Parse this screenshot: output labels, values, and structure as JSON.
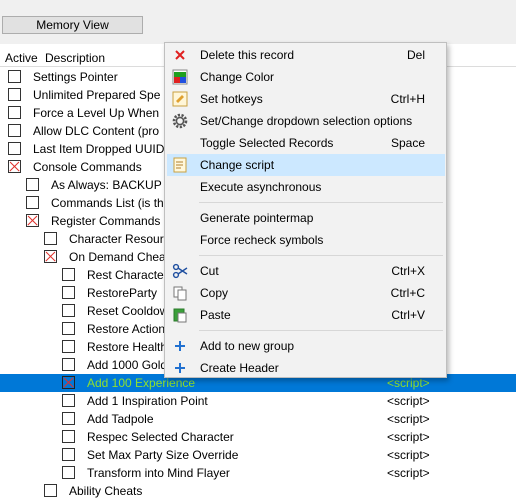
{
  "toolbar": {
    "memory_view_label": "Memory View"
  },
  "columns": {
    "active": "Active",
    "description": "Description"
  },
  "rows": [
    {
      "desc": "Settings Pointer",
      "value": "",
      "checked": false,
      "selected": false,
      "indent": 1
    },
    {
      "desc": "Unlimited Prepared Spe",
      "value": "",
      "checked": false,
      "selected": false,
      "indent": 1
    },
    {
      "desc": "Force a Level Up When",
      "value": "",
      "checked": false,
      "selected": false,
      "indent": 1
    },
    {
      "desc": "Allow DLC Content (pro",
      "value": "",
      "checked": false,
      "selected": false,
      "indent": 1
    },
    {
      "desc": "Last Item Dropped UUID",
      "value": "",
      "checked": false,
      "selected": false,
      "indent": 1
    },
    {
      "desc": "Console Commands",
      "value": "",
      "checked": true,
      "selected": false,
      "indent": 1
    },
    {
      "desc": "As Always: BACKUP Y",
      "value": "",
      "checked": false,
      "selected": false,
      "indent": 2
    },
    {
      "desc": "Commands List (is th",
      "value": "",
      "checked": false,
      "selected": false,
      "indent": 2
    },
    {
      "desc": "Register Commands",
      "value": "",
      "checked": true,
      "selected": false,
      "indent": 2
    },
    {
      "desc": "Character Resourc",
      "value": "",
      "checked": false,
      "selected": false,
      "indent": 3
    },
    {
      "desc": "On Demand Cheat",
      "value": "",
      "checked": true,
      "selected": false,
      "indent": 3
    },
    {
      "desc": "Rest Character",
      "value": "",
      "checked": false,
      "selected": false,
      "indent": 4
    },
    {
      "desc": "RestoreParty",
      "value": "",
      "checked": false,
      "selected": false,
      "indent": 4
    },
    {
      "desc": "Reset Cooldow",
      "value": "",
      "checked": false,
      "selected": false,
      "indent": 4
    },
    {
      "desc": "Restore Action",
      "value": "",
      "checked": false,
      "selected": false,
      "indent": 4
    },
    {
      "desc": "Restore Health",
      "value": "",
      "checked": false,
      "selected": false,
      "indent": 4
    },
    {
      "desc": "Add 1000 Gold",
      "value": "",
      "checked": false,
      "selected": false,
      "indent": 4
    },
    {
      "desc": "Add 100 Experience",
      "value": "<script>",
      "checked": true,
      "selected": true,
      "indent": 4
    },
    {
      "desc": "Add 1 Inspiration Point",
      "value": "<script>",
      "checked": false,
      "selected": false,
      "indent": 4
    },
    {
      "desc": "Add Tadpole",
      "value": "<script>",
      "checked": false,
      "selected": false,
      "indent": 4
    },
    {
      "desc": "Respec Selected Character",
      "value": "<script>",
      "checked": false,
      "selected": false,
      "indent": 4
    },
    {
      "desc": "Set Max Party Size Override",
      "value": "<script>",
      "checked": false,
      "selected": false,
      "indent": 4
    },
    {
      "desc": "Transform into Mind Flayer",
      "value": "<script>",
      "checked": false,
      "selected": false,
      "indent": 4
    },
    {
      "desc": "Ability Cheats",
      "value": "",
      "checked": false,
      "selected": false,
      "indent": 3
    }
  ],
  "context_menu": {
    "delete": {
      "label": "Delete this record",
      "shortcut": "Del"
    },
    "change_color": {
      "label": "Change Color"
    },
    "set_hotkeys": {
      "label": "Set hotkeys",
      "shortcut": "Ctrl+H"
    },
    "dropdown_options": {
      "label": "Set/Change dropdown selection options"
    },
    "toggle_selected": {
      "label": "Toggle Selected Records",
      "shortcut": "Space"
    },
    "change_script": {
      "label": "Change script"
    },
    "execute_async": {
      "label": "Execute asynchronous"
    },
    "generate_pointermap": {
      "label": "Generate pointermap"
    },
    "force_recheck": {
      "label": "Force recheck symbols"
    },
    "cut": {
      "label": "Cut",
      "shortcut": "Ctrl+X"
    },
    "copy": {
      "label": "Copy",
      "shortcut": "Ctrl+C"
    },
    "paste": {
      "label": "Paste",
      "shortcut": "Ctrl+V"
    },
    "add_group": {
      "label": "Add to new group"
    },
    "create_header": {
      "label": "Create Header"
    }
  },
  "colors": {
    "selection": "#0078d7",
    "selected_text": "#8fe02e",
    "menu_highlight": "#cce8ff",
    "check_mark": "#e0302a"
  }
}
